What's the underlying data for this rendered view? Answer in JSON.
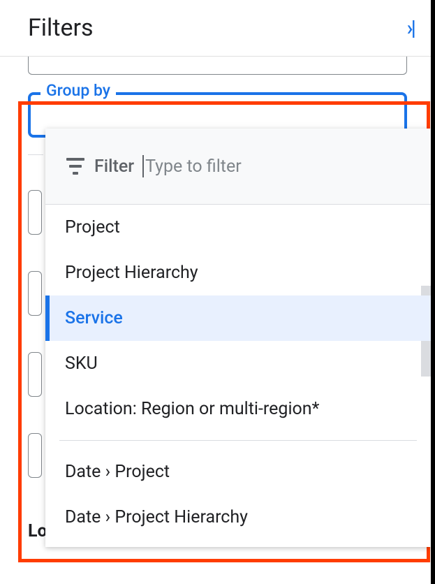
{
  "header": {
    "title": "Filters"
  },
  "group_by": {
    "label": "Group by"
  },
  "filter": {
    "label": "Filter",
    "placeholder": "Type to filter"
  },
  "options": {
    "group1": [
      "Project",
      "Project Hierarchy",
      "Service",
      "SKU",
      "Location: Region or multi-region*"
    ],
    "group2": [
      "Date › Project",
      "Date › Project Hierarchy"
    ],
    "selected_index": 2
  },
  "sections": {
    "locations": "Locations"
  }
}
